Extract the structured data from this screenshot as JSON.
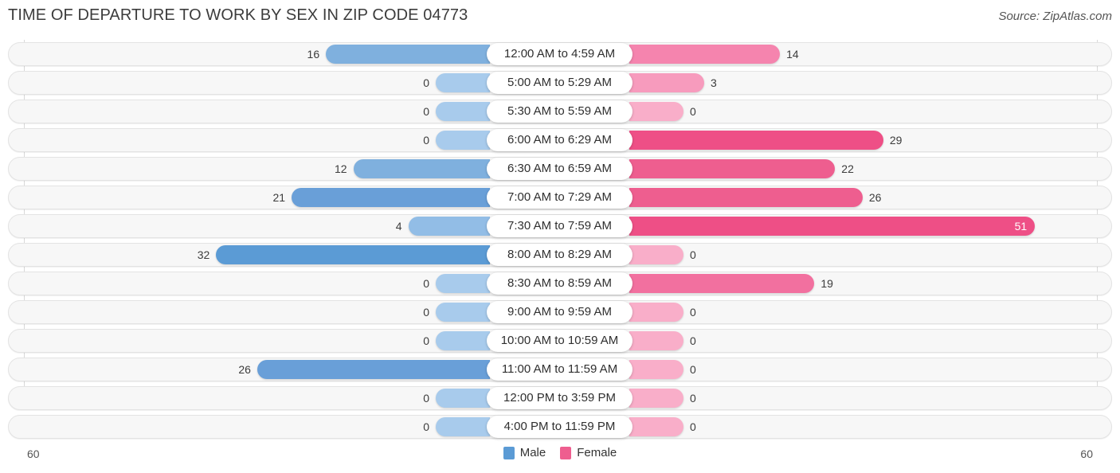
{
  "header": {
    "title": "TIME OF DEPARTURE TO WORK BY SEX IN ZIP CODE 04773",
    "source": "Source: ZipAtlas.com"
  },
  "legend": {
    "male_label": "Male",
    "female_label": "Female",
    "male_color": "#5b9bd5",
    "female_color": "#ee5e8f"
  },
  "axis": {
    "left_max": "60",
    "right_max": "60"
  },
  "chart_data": {
    "type": "bar",
    "orientation": "horizontal-diverging",
    "title": "TIME OF DEPARTURE TO WORK BY SEX IN ZIP CODE 04773",
    "xlabel": "",
    "ylabel": "",
    "xlim": [
      60,
      60
    ],
    "grid": true,
    "legend_position": "bottom-center",
    "categories": [
      "12:00 AM to 4:59 AM",
      "5:00 AM to 5:29 AM",
      "5:30 AM to 5:59 AM",
      "6:00 AM to 6:29 AM",
      "6:30 AM to 6:59 AM",
      "7:00 AM to 7:29 AM",
      "7:30 AM to 7:59 AM",
      "8:00 AM to 8:29 AM",
      "8:30 AM to 8:59 AM",
      "9:00 AM to 9:59 AM",
      "10:00 AM to 10:59 AM",
      "11:00 AM to 11:59 AM",
      "12:00 PM to 3:59 PM",
      "4:00 PM to 11:59 PM"
    ],
    "series": [
      {
        "name": "Male",
        "color": "#5b9bd5",
        "values": [
          16,
          0,
          0,
          0,
          12,
          21,
          4,
          32,
          0,
          0,
          0,
          26,
          0,
          0
        ]
      },
      {
        "name": "Female",
        "color": "#ee5e8f",
        "values": [
          14,
          3,
          0,
          29,
          22,
          26,
          51,
          0,
          19,
          0,
          0,
          0,
          0,
          0
        ]
      }
    ]
  }
}
